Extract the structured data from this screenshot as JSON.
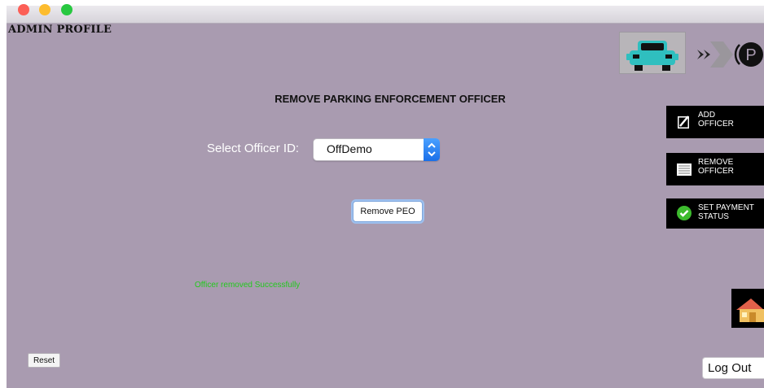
{
  "window": {
    "controls": [
      "close",
      "minimize",
      "maximize"
    ]
  },
  "header": {
    "title": "ADMIN PROFILE",
    "logo_icons": [
      "car-icon",
      "double-chevron-icon",
      "parking-icon"
    ],
    "logo_letter": "P"
  },
  "main": {
    "heading": "REMOVE PARKING ENFORCEMENT OFFICER",
    "select_label": "Select Officer ID:",
    "selected_officer": "OffDemo",
    "remove_button": "Remove PEO",
    "status_message": "Officer removed Successfully"
  },
  "sidebar": {
    "items": [
      {
        "label": "ADD\nOFFICER",
        "icon": "edit-icon"
      },
      {
        "label": "REMOVE\nOFFICER",
        "icon": "list-icon"
      },
      {
        "label": "SET PAYMENT\nSTATUS",
        "icon": "check-circle-icon"
      }
    ],
    "home_icon": "home-icon"
  },
  "footer": {
    "reset_label": "Reset",
    "logout_label": "Log Out"
  },
  "colors": {
    "background": "#a99bb0",
    "success_text": "#22c91d",
    "sidebar_button": "#000000",
    "car": "#2fbfbf"
  }
}
